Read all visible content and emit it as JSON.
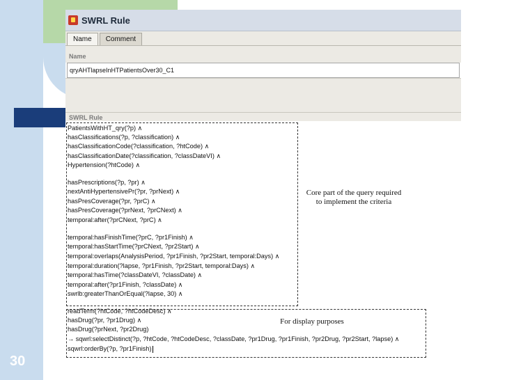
{
  "slide_number": "30",
  "window": {
    "title": "SWRL Rule"
  },
  "tabs": [
    {
      "label": "Name",
      "active": true
    },
    {
      "label": "Comment",
      "active": false
    }
  ],
  "name_section": {
    "label": "Name",
    "value": "qryAHTlapseInHTPatientsOver30_C1"
  },
  "swrl_section": {
    "label": "SWRL Rule"
  },
  "rule_lines": [
    "PatientsWithHT_qry(?p)  ∧",
    "hasClassifications(?p, ?classification)  ∧",
    "hasClassificationCode(?classification, ?htCode)  ∧",
    "hasClassificationDate(?classification, ?classDateVI)  ∧",
    "Hypertension(?htCode)  ∧",
    "",
    "hasPrescriptions(?p, ?pr)  ∧",
    "nextAntiHypertensivePr(?pr, ?prNext)  ∧",
    "hasPresCoverage(?pr, ?prC)  ∧",
    "hasPresCoverage(?prNext, ?prCNext)  ∧",
    "temporal:after(?prCNext, ?prC)  ∧",
    "",
    "temporal:hasFinishTime(?prC, ?pr1Finish)  ∧",
    "temporal:hasStartTime(?prCNext, ?pr2Start)  ∧",
    "temporal:overlaps(AnalysisPeriod, ?pr1Finish, ?pr2Start, temporal:Days)  ∧",
    "temporal:duration(?lapse, ?pr1Finish, ?pr2Start, temporal:Days)  ∧",
    "temporal:hasTime(?classDateVI, ?classDate)  ∧",
    "temporal:after(?pr1Finish, ?classDate)  ∧",
    "swrlb:greaterThanOrEqual(?lapse, 30)  ∧",
    "readTerm(?htCode, ?htCodeDesc)  ∧",
    "hasDrug(?pr, ?pr1Drug)  ∧",
    "hasDrug(?prNext, ?pr2Drug)",
    "  → sqwrl:selectDistinct(?p, ?htCode, ?htCodeDesc, ?classDate, ?pr1Drug, ?pr1Finish, ?pr2Drug, ?pr2Start, ?lapse)  ∧",
    "sqwrl:orderBy(?p, ?pr1Finish)"
  ],
  "annotations": {
    "core_line1": "Core part of the query required",
    "core_line2": "to implement the criteria",
    "display": "For display purposes"
  }
}
